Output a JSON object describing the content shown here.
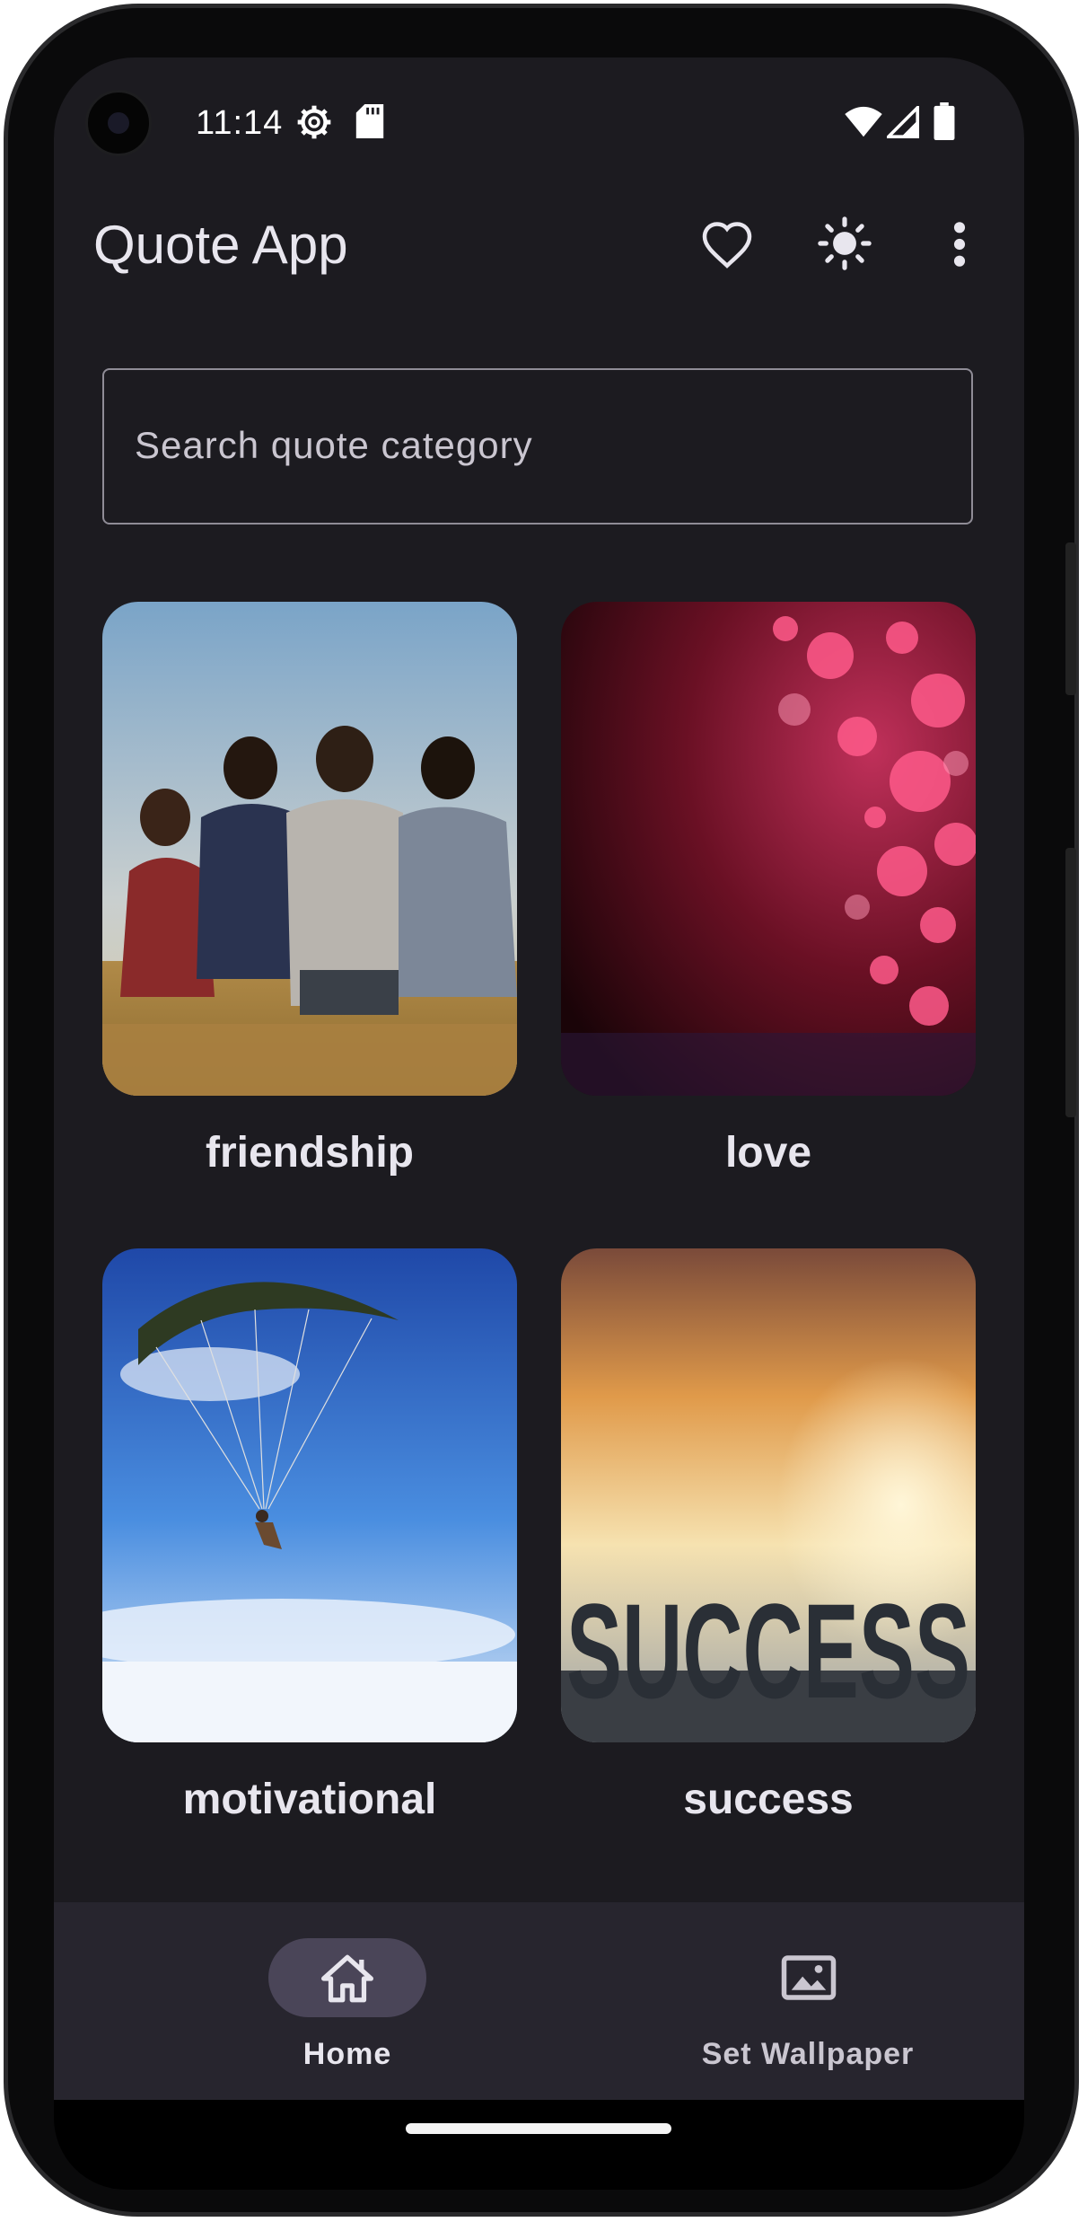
{
  "status_bar": {
    "time": "11:14",
    "icons": [
      "settings-gear-icon",
      "sd-card-icon",
      "wifi-icon",
      "signal-icon",
      "battery-icon"
    ]
  },
  "app_bar": {
    "title": "Quote App",
    "actions": [
      "favorite-heart-icon",
      "theme-brightness-icon",
      "more-vert-icon"
    ]
  },
  "search": {
    "placeholder": "Search quote category"
  },
  "categories": [
    {
      "label": "friendship",
      "image": "friends-in-field-photo"
    },
    {
      "label": "love",
      "image": "red-hearts-bokeh-photo"
    },
    {
      "label": "motivational",
      "image": "paraglider-sky-photo"
    },
    {
      "label": "success",
      "image": "success-sunset-photo"
    }
  ],
  "bottom_nav": {
    "items": [
      {
        "label": "Home",
        "icon": "home-icon",
        "selected": true
      },
      {
        "label": "Set Wallpaper",
        "icon": "image-icon",
        "selected": false
      }
    ]
  },
  "colors": {
    "background": "#1c1b20",
    "nav_background": "#27252e",
    "nav_pill": "#4a4558",
    "text": "#e8e6ee"
  }
}
